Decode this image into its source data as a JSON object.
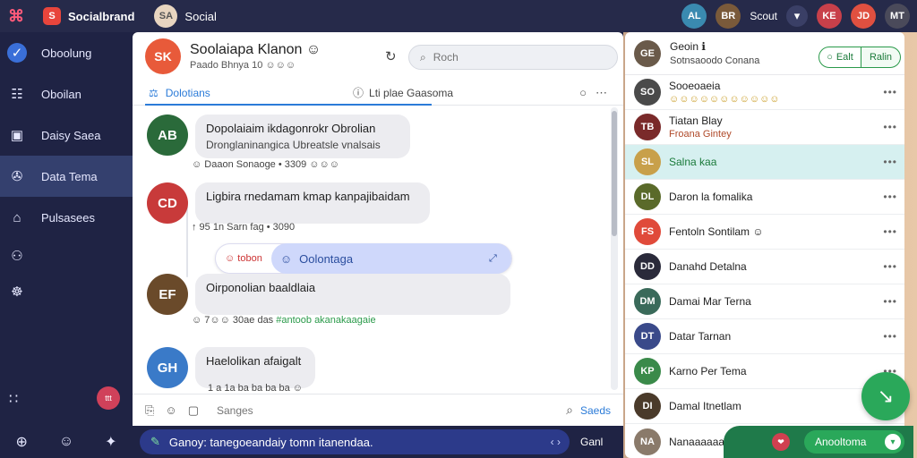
{
  "topbar": {
    "logo_glyph": "⌘",
    "brand_badge": "S",
    "brand_name": "Socialbrand",
    "user_avatar_initials": "SA",
    "user_name": "Social",
    "right_name": "Scout",
    "right_more": "▾",
    "right_avatars": [
      {
        "initials": "AL",
        "color": "#3a8ab0"
      },
      {
        "initials": "BR",
        "color": "#7a5a3a"
      },
      {
        "initials": "KE",
        "color": "#c8404a"
      },
      {
        "initials": "JD",
        "color": "#e05040"
      },
      {
        "initials": "MT",
        "color": "#4a4a5a"
      }
    ]
  },
  "sidebar": {
    "items": [
      {
        "label": "Oboolung",
        "icon": "✓"
      },
      {
        "label": "Oboilan",
        "icon": "☷"
      },
      {
        "label": "Daisy Saea",
        "icon": "▣"
      },
      {
        "label": "Data Tema",
        "icon": "✇"
      },
      {
        "label": "Pulsasees",
        "icon": "⌂"
      }
    ],
    "icon_items": [
      "⚇",
      "☸"
    ],
    "grid_icon": "∷",
    "badge": "ttt",
    "bottom_icons": [
      "⊕",
      "☺",
      "✦"
    ]
  },
  "chat": {
    "title": "Soolaiapa Klanon",
    "title_emoji": "☺",
    "subtitle": "Paado Bhnya 10 ☺☺☺",
    "avatar_initials": "SK",
    "search_placeholder": "Roch",
    "tab_active": "Dolotians",
    "tab_info": "Lti plae Gaasoma",
    "messages": [
      {
        "avatar": "AB",
        "color": "#2a6a3a",
        "line1": "Dopolaiaim ikdagonrokr Obrolian",
        "line2": "Dronglaninangica Ubreatsle vnalsais"
      },
      {
        "avatar": "CD",
        "color": "#c83a3a",
        "line1": "Ligbira rnedamam kmap kanpajibaidam",
        "line2": ""
      },
      {
        "avatar": "EF",
        "color": "#6a4a2a",
        "line1": "Oirponolian baaldlaia",
        "line2": ""
      },
      {
        "avatar": "GH",
        "color": "#3a7ac8",
        "line1": "Haelolikan afaigalt",
        "line2": ""
      }
    ],
    "meta1": "☺ Daaon Sonaoge • 3309 ☺☺☺",
    "meta2": "↑ 95 1n Sarn fag • 3090",
    "meta3_a": "☺ 7☺☺ 30ae das",
    "meta3_b": "#antoob akanakaagaie",
    "meta4": "1 a 1a ba ba ba ba ☺",
    "reply_left": "☺ tobon",
    "reply_right": "Oolontaga",
    "composer_placeholder": "Sanges",
    "send_label": "Saeds"
  },
  "bottom_input": {
    "text": "Ganoy: tanegoeandaiy tomn itanendaa.",
    "nav": "‹ ›",
    "send": "Ganl"
  },
  "contacts": {
    "header_name": "Geoin ℹ",
    "header_sub": "Sotnsaoodo Conana",
    "btn_follow": "Ealt",
    "btn_more": "Ralin",
    "rows": [
      {
        "avatar": "SO",
        "color": "#4a4a4a",
        "name": "Sooeoaeia",
        "sub": "☺☺☺☺☺☺☺☺☺☺☺",
        "active": false
      },
      {
        "avatar": "TB",
        "color": "#7a2a2a",
        "name": "Tiatan Blay",
        "sub": "Froana Gintey",
        "active": false
      },
      {
        "avatar": "SL",
        "color": "#c8a04a",
        "name": "Salna kaa",
        "sub": "",
        "active": true
      },
      {
        "avatar": "DL",
        "color": "#5a6a2a",
        "name": "Daron la fomalika",
        "sub": "",
        "active": false
      },
      {
        "avatar": "FS",
        "color": "#e04a3a",
        "name": "Fentoln Sontilam ☺",
        "sub": "",
        "active": false
      },
      {
        "avatar": "DD",
        "color": "#2a2a3a",
        "name": "Danahd Detalna",
        "sub": "",
        "active": false
      },
      {
        "avatar": "DM",
        "color": "#3a6a5a",
        "name": "Damai Mar Terna",
        "sub": "",
        "active": false
      },
      {
        "avatar": "DT",
        "color": "#3a4a8a",
        "name": "Datar Tarnan",
        "sub": "",
        "active": false
      },
      {
        "avatar": "KP",
        "color": "#3a8a4a",
        "name": "Karno Per Tema",
        "sub": "",
        "active": false
      },
      {
        "avatar": "DI",
        "color": "#4a3a2a",
        "name": "Damal Itnetlam",
        "sub": "",
        "active": false
      }
    ],
    "more": "•••"
  },
  "right_bottom": {
    "user_avatar": "NA",
    "user_name": "Nanaaaaaae",
    "badge": "❤",
    "pill_label": "Anooltoma",
    "pill_chevron": "▾",
    "fab_icon": "↘"
  },
  "colors": {
    "accent": "#2b7bd8",
    "green": "#2aa85a",
    "nav_bg": "#1f2344"
  }
}
